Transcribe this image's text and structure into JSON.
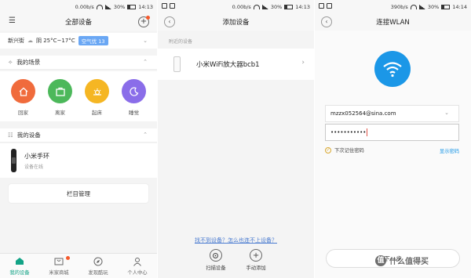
{
  "phone1": {
    "status": {
      "speed": "0.00b/s",
      "battery": "30%",
      "time": "14:13"
    },
    "title": "全部设备",
    "weather": {
      "location": "新兴街",
      "condition": "阴 25°C~17°C",
      "air_quality": "空气优 13"
    },
    "scenes_header": "我的场景",
    "scenes": [
      {
        "label": "回家",
        "color": "#f06b3c",
        "icon": "home-icon"
      },
      {
        "label": "离家",
        "color": "#4cb85a",
        "icon": "briefcase-icon"
      },
      {
        "label": "起床",
        "color": "#f5b623",
        "icon": "sun-icon"
      },
      {
        "label": "睡觉",
        "color": "#8a6de9",
        "icon": "moon-icon"
      }
    ],
    "devices_header": "我的设备",
    "device": {
      "name": "小米手环",
      "status": "设备在线"
    },
    "manage_label": "栏目管理",
    "tabs": [
      {
        "label": "我的设备",
        "active": true,
        "icon": "home-tab-icon"
      },
      {
        "label": "米家商城",
        "active": false,
        "icon": "store-icon"
      },
      {
        "label": "发现酷玩",
        "active": false,
        "icon": "compass-icon"
      },
      {
        "label": "个人中心",
        "active": false,
        "icon": "person-icon"
      }
    ]
  },
  "phone2": {
    "status": {
      "speed": "0.00b/s",
      "battery": "30%",
      "time": "14:13"
    },
    "title": "添加设备",
    "nearby_label": "附近的设备",
    "device_name": "小米WiFi放大器bcb1",
    "help_link": "找不到设备？怎么也连不上设备？",
    "actions": [
      {
        "label": "扫描设备",
        "icon": "scan-icon"
      },
      {
        "label": "手动添加",
        "icon": "plus-icon"
      }
    ]
  },
  "phone3": {
    "status": {
      "speed": "390b/s",
      "battery": "30%",
      "time": "14:14"
    },
    "title": "连接WLAN",
    "ssid": "mzzx052564@sina.com",
    "password": "•••••••••••",
    "remember_label": "下次记住密码",
    "show_password": "显示密码",
    "next_label": "下一步"
  },
  "watermark": {
    "logo_char": "值",
    "text": "什么值得买"
  }
}
